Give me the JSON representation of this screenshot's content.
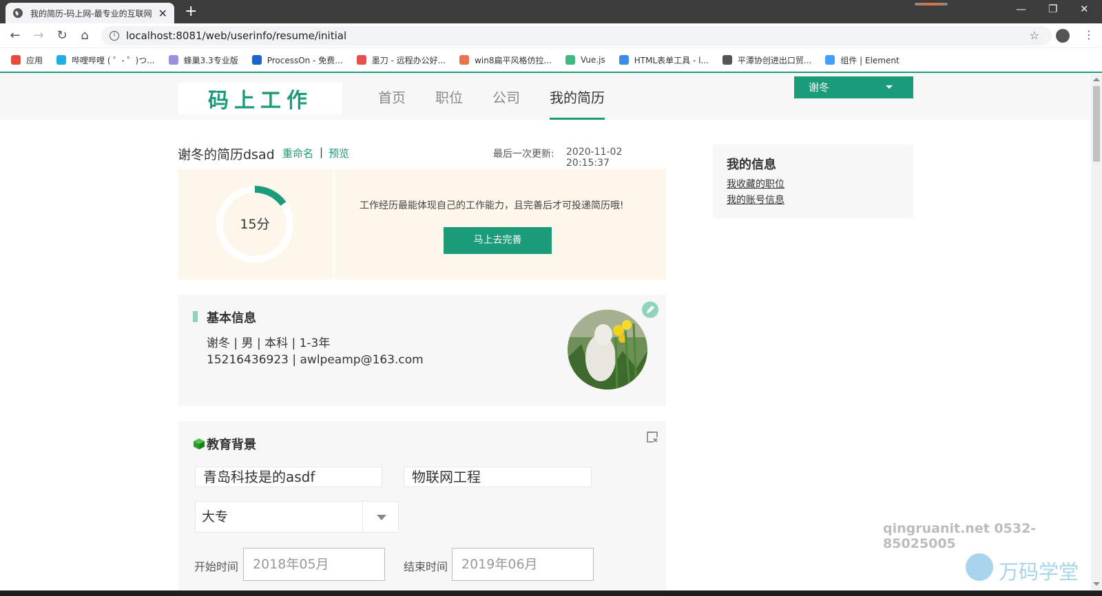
{
  "browser": {
    "tab_title": "我的简历-码上网-最专业的互联网",
    "url": "localhost:8081/web/userinfo/resume/initial",
    "bookmarks": [
      {
        "label": "应用",
        "color": "#e54c3c"
      },
      {
        "label": "哔哩哔哩 ( ゜- ゜)つ...",
        "color": "#23ade5"
      },
      {
        "label": "蜂巢3.3专业版",
        "color": "#9b8fe0"
      },
      {
        "label": "ProcessOn - 免费...",
        "color": "#1b64c8"
      },
      {
        "label": "墨刀 - 远程办公好...",
        "color": "#e84f4f"
      },
      {
        "label": "win8扁平风格仿拉...",
        "color": "#e8734f"
      },
      {
        "label": "Vue.js",
        "color": "#42b883"
      },
      {
        "label": "HTML表单工具 - l...",
        "color": "#3a8ee6"
      },
      {
        "label": "平潭协创进出口贸...",
        "color": "#555555"
      },
      {
        "label": "组件 | Element",
        "color": "#409eff"
      }
    ]
  },
  "header": {
    "logo": "码上工作",
    "nav": [
      "首页",
      "职位",
      "公司",
      "我的简历"
    ],
    "active_nav": "我的简历",
    "user_name": "谢冬"
  },
  "resume": {
    "title": "谢冬的简历dsad",
    "rename_label": "重命名",
    "preview_label": "预览",
    "separator": "|",
    "updated_label": "最后一次更新:",
    "updated_at": "2020-11-02 20:15:37"
  },
  "score": {
    "value": 15,
    "text": "15分",
    "tip": "工作经历最能体现自己的工作能力，且完善后才可投递简历哦!",
    "button": "马上去完善"
  },
  "basic_info": {
    "title": "基本信息",
    "line1": "谢冬 | 男 | 本科 | 1-3年",
    "line2": "15216436923 | awlpeamp@163.com"
  },
  "education": {
    "title": "教育背景",
    "school": "青岛科技是的asdf",
    "major": "物联网工程",
    "degree": "大专",
    "start_label": "开始时间",
    "start_value": "2018年05月",
    "end_label": "结束时间",
    "end_value": "2019年06月"
  },
  "sidebar": {
    "title": "我的信息",
    "links": [
      "我收藏的职位",
      "我的账号信息"
    ]
  },
  "watermark": {
    "contact": "qingruanit.net 0532-85025005",
    "brand": "万码学堂"
  },
  "colors": {
    "accent": "#1a9b79",
    "panel": "#fdf6eb",
    "card": "#f7f7f7"
  }
}
